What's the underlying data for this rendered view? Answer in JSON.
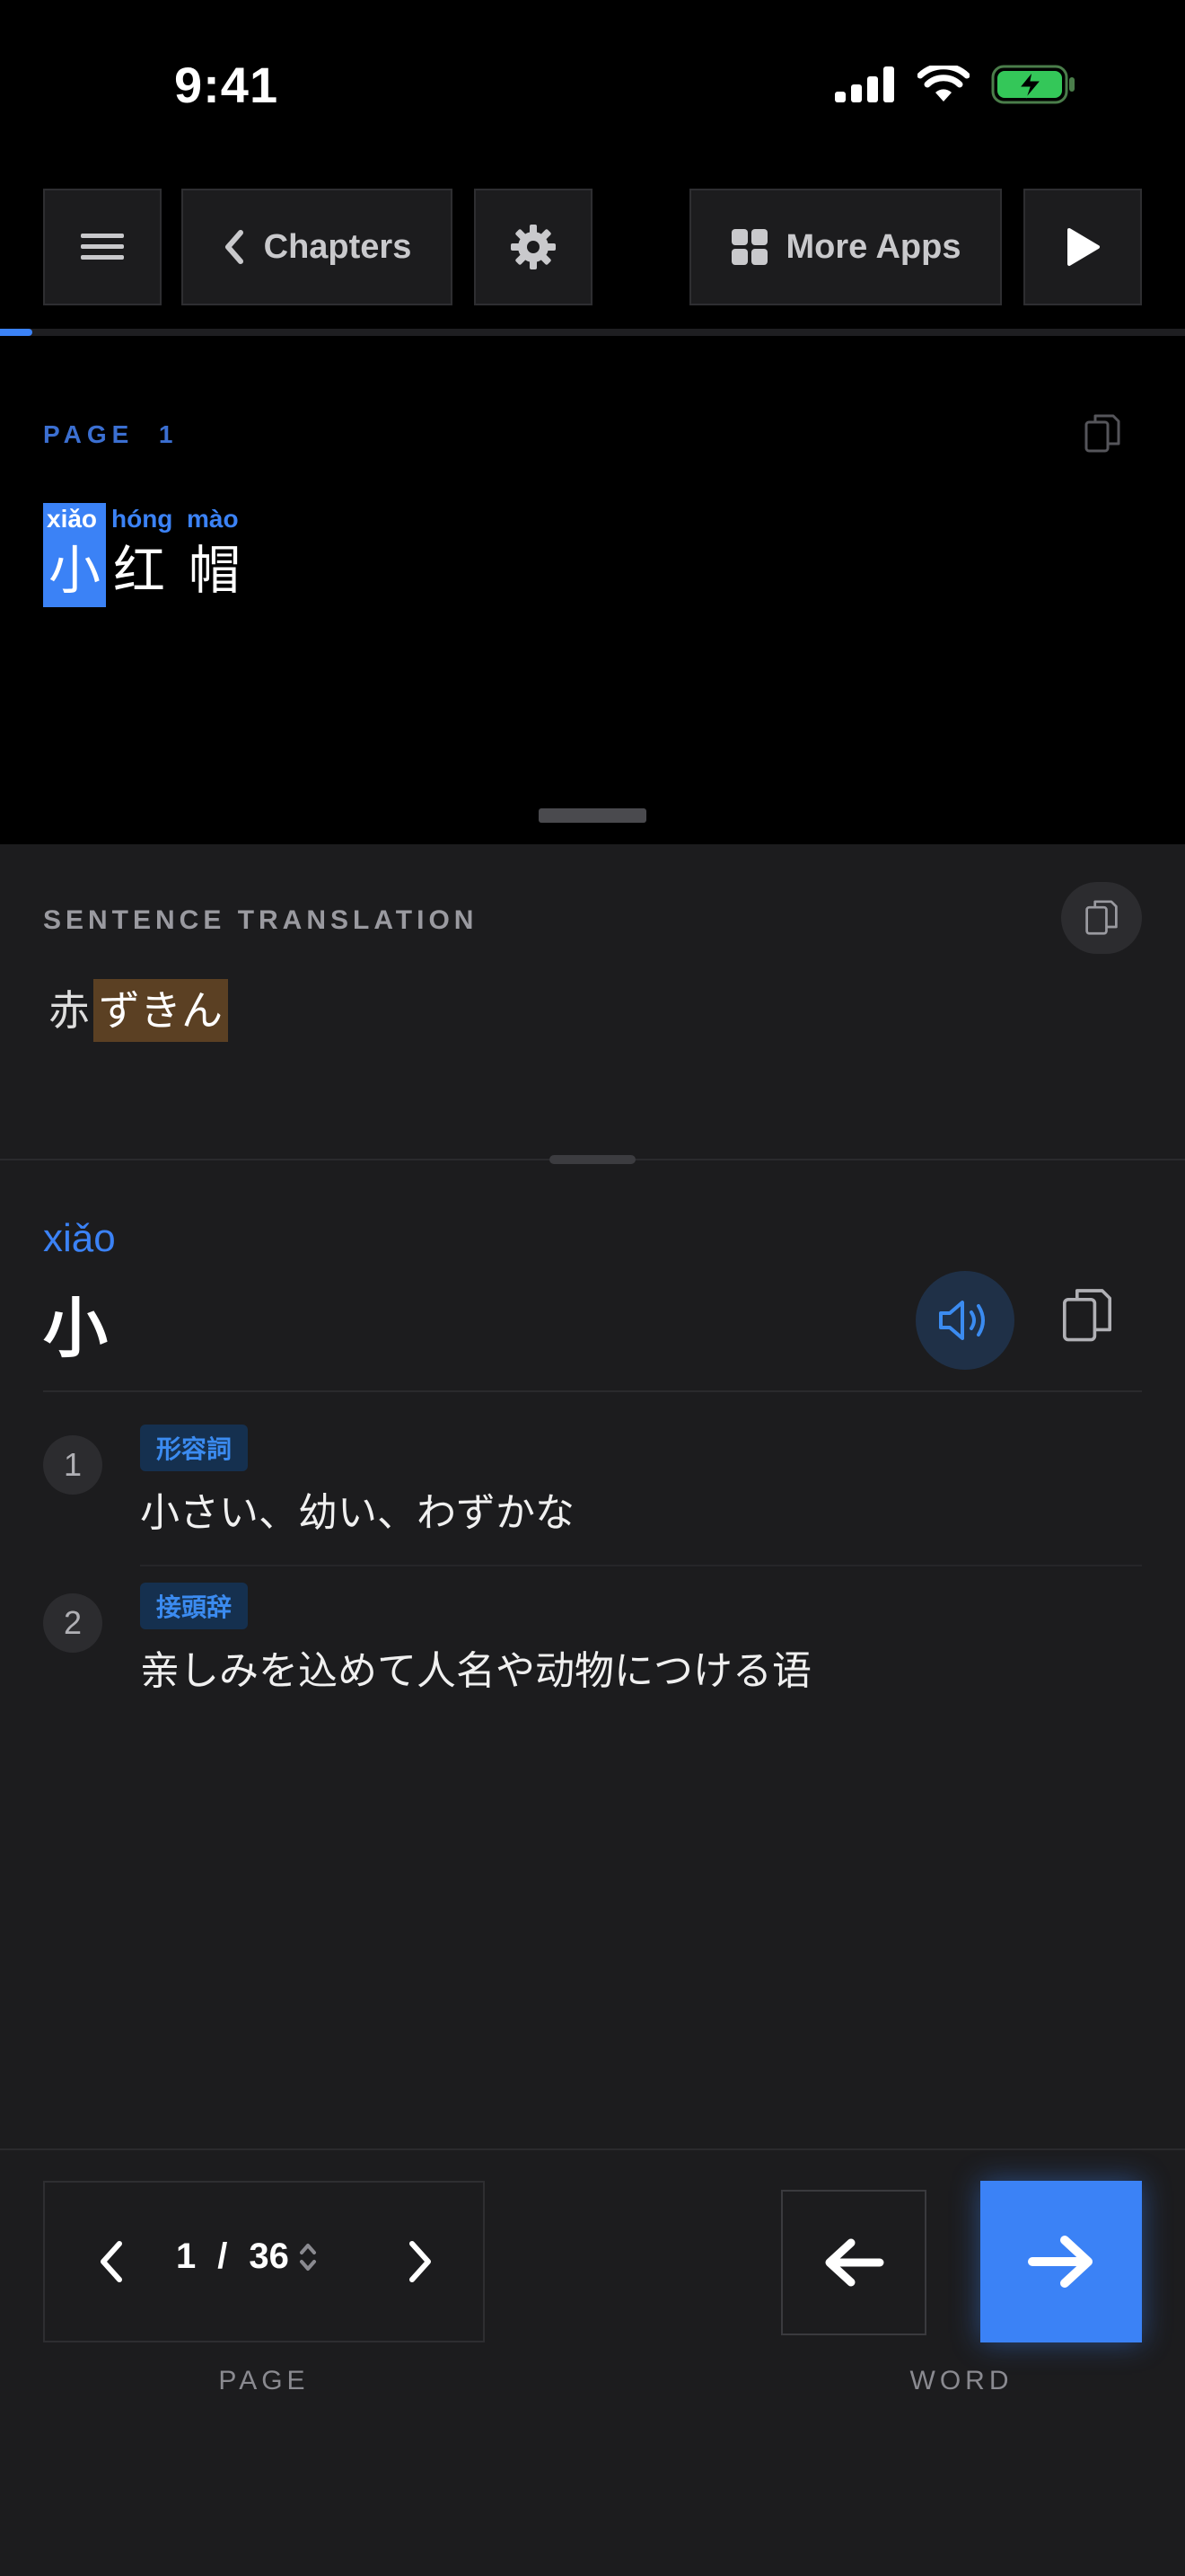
{
  "status_bar": {
    "time": "9:41"
  },
  "toolbar": {
    "chapters_label": "Chapters",
    "more_apps_label": "More Apps"
  },
  "reader": {
    "page_label": "PAGE  1",
    "words": [
      {
        "pinyin": "xiǎo",
        "hanzi": "小"
      },
      {
        "pinyin": "hóng",
        "hanzi": "红"
      },
      {
        "pinyin": "mào",
        "hanzi": "帽"
      }
    ]
  },
  "translation": {
    "label": "SENTENCE TRANSLATION",
    "plain": "赤",
    "highlight": "ずきん"
  },
  "dictionary": {
    "pinyin": "xiǎo",
    "hanzi": "小",
    "definitions": [
      {
        "num": "1",
        "tag": "形容詞",
        "text": "小さい、幼い、わずかな"
      },
      {
        "num": "2",
        "tag": "接頭辞",
        "text": "亲しみを込めて人名や动物につける语"
      }
    ]
  },
  "bottom_nav": {
    "current_page": "1",
    "separator": "/",
    "total_pages": "36",
    "page_caption": "PAGE",
    "word_caption": "WORD"
  },
  "colors": {
    "accent": "#3b82f6",
    "background": "#000000",
    "panel": "#1c1c1e",
    "highlight": "#5b4023",
    "tag_bg": "#15304f"
  }
}
